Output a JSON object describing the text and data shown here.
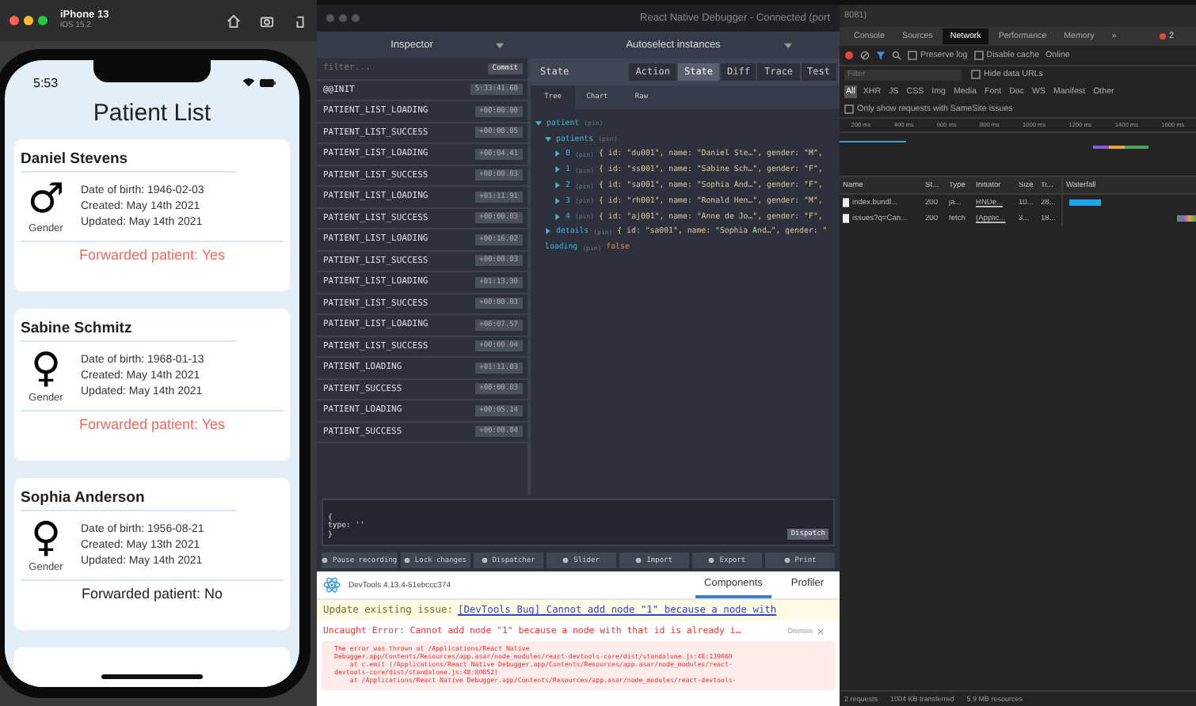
{
  "simulator": {
    "device": "iPhone 13",
    "os": "iOS 15.2"
  },
  "phone": {
    "time": "5:53",
    "title": "Patient List",
    "patients": [
      {
        "name": "Daniel Stevens",
        "gender_symbol": "♂",
        "gender_label": "Gender",
        "dob": "Date of birth: 1946-02-03",
        "created": "Created: May 14th 2021",
        "updated": "Updated: May 14th 2021",
        "forwarded_text": "Forwarded patient: Yes",
        "forwarded": true
      },
      {
        "name": "Sabine Schmitz",
        "gender_symbol": "♀",
        "gender_label": "Gender",
        "dob": "Date of birth: 1968-01-13",
        "created": "Created: May 14th 2021",
        "updated": "Updated: May 14th 2021",
        "forwarded_text": "Forwarded patient: Yes",
        "forwarded": true
      },
      {
        "name": "Sophia Anderson",
        "gender_symbol": "♀",
        "gender_label": "Gender",
        "dob": "Date of birth: 1956-08-21",
        "created": "Created: May 13th 2021",
        "updated": "Updated: May 14th 2021",
        "forwarded_text": "Forwarded patient: No",
        "forwarded": false
      }
    ]
  },
  "debugger": {
    "title": "React Native Debugger - Connected (port",
    "monitor": "Inspector",
    "instances": "Autoselect instances",
    "filter_placeholder": "filter...",
    "commit": "Commit",
    "actions": [
      {
        "type": "@@INIT",
        "time": "5:33:41.60"
      },
      {
        "type": "PATIENT_LIST_LOADING",
        "time": "+00:00.00"
      },
      {
        "type": "PATIENT_LIST_SUCCESS",
        "time": "+00:00.05"
      },
      {
        "type": "PATIENT_LIST_LOADING",
        "time": "+00:04.41"
      },
      {
        "type": "PATIENT_LIST_SUCCESS",
        "time": "+00:00.03"
      },
      {
        "type": "PATIENT_LIST_LOADING",
        "time": "+01:11.91"
      },
      {
        "type": "PATIENT_LIST_SUCCESS",
        "time": "+00:00.03"
      },
      {
        "type": "PATIENT_LIST_LOADING",
        "time": "+00:16.02"
      },
      {
        "type": "PATIENT_LIST_SUCCESS",
        "time": "+00:00.03"
      },
      {
        "type": "PATIENT_LIST_LOADING",
        "time": "+01:13.30"
      },
      {
        "type": "PATIENT_LIST_SUCCESS",
        "time": "+00:00.03"
      },
      {
        "type": "PATIENT_LIST_LOADING",
        "time": "+00:07.57"
      },
      {
        "type": "PATIENT_LIST_SUCCESS",
        "time": "+00:00.04"
      },
      {
        "type": "PATIENT_LOADING",
        "time": "+01:11.03"
      },
      {
        "type": "PATIENT_SUCCESS",
        "time": "+00:00.03"
      },
      {
        "type": "PATIENT_LOADING",
        "time": "+00:05.14"
      },
      {
        "type": "PATIENT_SUCCESS",
        "time": "+00:00.04"
      }
    ],
    "state_label": "State",
    "mode_tabs": [
      {
        "label": "Action",
        "selected": false
      },
      {
        "label": "State",
        "selected": true
      },
      {
        "label": "Diff",
        "selected": false
      },
      {
        "label": "Trace",
        "selected": false
      },
      {
        "label": "Test",
        "selected": false
      }
    ],
    "view_tabs": [
      {
        "label": "Tree",
        "selected": true
      },
      {
        "label": "Chart",
        "selected": false
      },
      {
        "label": "Raw",
        "selected": false
      }
    ],
    "tree": [
      {
        "key": "patient",
        "type": "(pin)",
        "kind": "object",
        "expanded": true,
        "children": [
          {
            "key": "patients",
            "type": "(pin)",
            "kind": "object",
            "expanded": true,
            "children": [
              {
                "key": "0",
                "type": "(pin)",
                "kind": "object",
                "value": "{ id: \"du001\", name: \"Daniel Ste…\", gender: \"M\",",
                "expanded": false
              },
              {
                "key": "1",
                "type": "(pin)",
                "kind": "object",
                "value": "{ id: \"ss001\", name: \"Sabine Sch…\", gender: \"F\",",
                "expanded": false
              },
              {
                "key": "2",
                "type": "(pin)",
                "kind": "object",
                "value": "{ id: \"sa001\", name: \"Sophia And…\", gender: \"F\",",
                "expanded": false
              },
              {
                "key": "3",
                "type": "(pin)",
                "kind": "object",
                "value": "{ id: \"rh001\", name: \"Ronald Hen…\", gender: \"M\",",
                "expanded": false
              },
              {
                "key": "4",
                "type": "(pin)",
                "kind": "object",
                "value": "{ id: \"aj001\", name: \"Anne de Jo…\", gender: \"F\",",
                "expanded": false
              }
            ]
          },
          {
            "key": "details",
            "type": "(pin)",
            "kind": "object",
            "value": "{ id: \"sa001\", name: \"Sophia And…\", gender: \"",
            "expanded": false
          },
          {
            "key": "loading",
            "type": "(pin)",
            "kind": "boolean",
            "value": "false"
          }
        ]
      }
    ],
    "dispatch_lines": [
      "{",
      "type: ''",
      "}"
    ],
    "dispatch_button": "Dispatch",
    "toolbar": [
      "Pause recording",
      "Lock changes",
      "Dispatcher",
      "Slider",
      "Import",
      "Export",
      "Print"
    ]
  },
  "react_devtools": {
    "version": "DevTools 4.13.4-51ebccc374",
    "tabs": [
      {
        "label": "Components",
        "selected": true
      },
      {
        "label": "Profiler",
        "selected": false
      }
    ],
    "issue_label": "Update existing issue:",
    "issue_link": "[DevTools Bug] Cannot add node \"1\" because a node with",
    "error": "Uncaught Error: Cannot add node \"1\" because a node with that id is already i…",
    "dismiss": "Dismiss",
    "stack": [
      "The error was thrown at /Applications/React Native",
      "Debugger.app/Contents/Resources/app.asar/node_modules/react-devtools-core/dist/standalone.js:48:139060",
      "    at c.emit (/Applications/React Native Debugger.app/Contents/Resources/app.asar/node_modules/react-",
      "devtools-core/dist/standalone.js:48:80852)",
      "    at /Applications/React Native Debugger.app/Contents/Resources/app.asar/node_modules/react-devtools-"
    ]
  },
  "chrome_devtools": {
    "title_tail": "8081)",
    "tabs": [
      {
        "label": "Console",
        "selected": false
      },
      {
        "label": "Sources",
        "selected": false
      },
      {
        "label": "Network",
        "selected": true
      },
      {
        "label": "Performance",
        "selected": false
      },
      {
        "label": "Memory",
        "selected": false
      },
      {
        "label": "»",
        "selected": false
      }
    ],
    "error_count": "2",
    "preserve_log": {
      "label": "Preserve log",
      "checked": false
    },
    "disable_cache": {
      "label": "Disable cache",
      "checked": false
    },
    "throttle": "Online",
    "filter_placeholder": "Filter",
    "hide_data_urls": {
      "label": "Hide data URLs",
      "checked": false
    },
    "type_filters": [
      {
        "label": "All",
        "selected": true
      },
      {
        "label": "XHR",
        "selected": false
      },
      {
        "label": "JS",
        "selected": false
      },
      {
        "label": "CSS",
        "selected": false
      },
      {
        "label": "Img",
        "selected": false
      },
      {
        "label": "Media",
        "selected": false
      },
      {
        "label": "Font",
        "selected": false
      },
      {
        "label": "Doc",
        "selected": false
      },
      {
        "label": "WS",
        "selected": false
      },
      {
        "label": "Manifest",
        "selected": false
      },
      {
        "label": "Other",
        "selected": false
      }
    ],
    "samesite": {
      "label": "Only show requests with SameSite issues",
      "checked": false
    },
    "ticks": [
      "200 ms",
      "400 ms",
      "600 ms",
      "800 ms",
      "1000 ms",
      "1200 ms",
      "1400 ms",
      "1600 ms"
    ],
    "columns": [
      "Name",
      "St...",
      "Type",
      "Initiator",
      "Size",
      "Ti...",
      "Waterfall"
    ],
    "rows": [
      {
        "cells": [
          "index.bundl...",
          "200",
          "ja...",
          "RNDe...",
          "10...",
          "28..."
        ]
      },
      {
        "cells": [
          "issues?q=Can...",
          "200",
          "fetch",
          "(Applic...",
          "3...",
          "18..."
        ]
      }
    ],
    "status": [
      "2 requests",
      "1004 KB transferred",
      "5.9 MB resources"
    ]
  }
}
